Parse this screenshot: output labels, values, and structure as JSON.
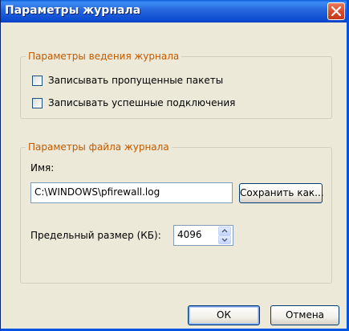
{
  "dialog": {
    "title": "Параметры журнала",
    "close_icon": "close-x-icon"
  },
  "logging_options": {
    "legend": "Параметры ведения журнала",
    "checkboxes": [
      {
        "label": "Записывать пропущенные пакеты",
        "checked": false
      },
      {
        "label": "Записывать успешные подключения",
        "checked": false
      }
    ]
  },
  "log_file": {
    "legend": "Параметры файла журнала",
    "name_label": "Имя:",
    "path_value": "C:\\WINDOWS\\pfirewall.log",
    "save_as_label": "Сохранить как...",
    "size_label": "Предельный размер (КБ):",
    "size_value": "4096",
    "spin_up_icon": "spin-up-arrow-icon",
    "spin_down_icon": "spin-down-arrow-icon"
  },
  "buttons": {
    "ok_label": "ОК",
    "cancel_label": "Отмена"
  },
  "colors": {
    "titlebar": "#2766dc",
    "legend_text": "#c25a00",
    "dialog_bg": "#ece9d8",
    "close_button": "#d9482a"
  }
}
